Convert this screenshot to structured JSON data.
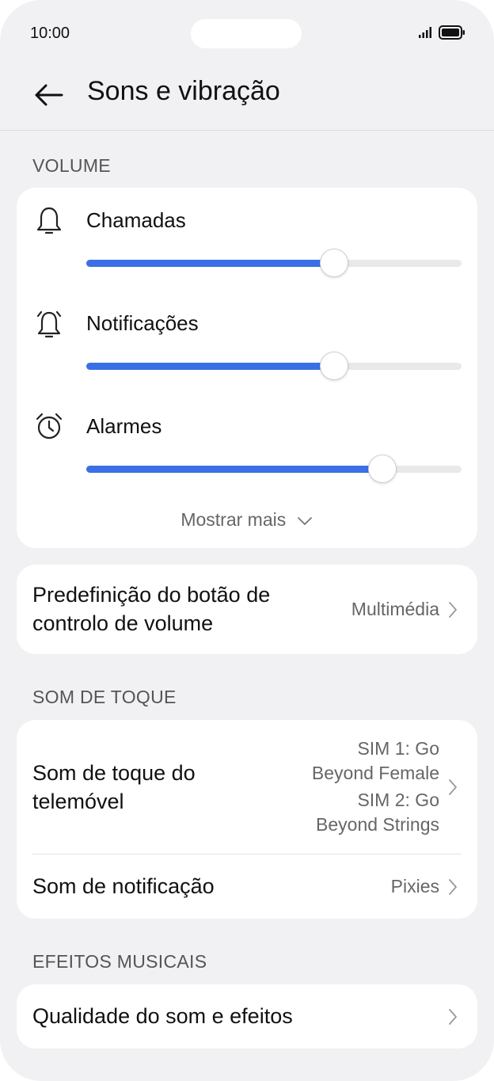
{
  "status_bar": {
    "time": "10:00",
    "icons": [
      "signal-icon",
      "battery-icon"
    ]
  },
  "header": {
    "title": "Sons e vibração",
    "back_icon": "arrow-left-icon"
  },
  "sections": {
    "volume_label": "VOLUME",
    "ringtone_label": "SOM DE TOQUE",
    "music_effects_label": "EFEITOS MUSICAIS"
  },
  "volume": {
    "items": [
      {
        "label": "Chamadas",
        "icon": "bell-icon",
        "level": 0.66
      },
      {
        "label": "Notificações",
        "icon": "bell-ring-icon",
        "level": 0.66
      },
      {
        "label": "Alarmes",
        "icon": "alarm-clock-icon",
        "level": 0.79
      }
    ],
    "show_more": "Mostrar mais",
    "accent": "#3b6fe6"
  },
  "volume_button": {
    "title_line1": "Predefinição do botão de",
    "title_line2": "controlo de volume",
    "value": "Multimédia"
  },
  "ringtone": {
    "phone_title_line1": "Som de toque do",
    "phone_title_line2": "telemóvel",
    "sim1_line1": "SIM 1: Go",
    "sim1_line2": "Beyond Female",
    "sim2_line1": "SIM 2: Go",
    "sim2_line2": "Beyond Strings",
    "notification_title": "Som de notificação",
    "notification_value": "Pixies"
  },
  "music_effects": {
    "quality_title": "Qualidade do som e efeitos"
  }
}
